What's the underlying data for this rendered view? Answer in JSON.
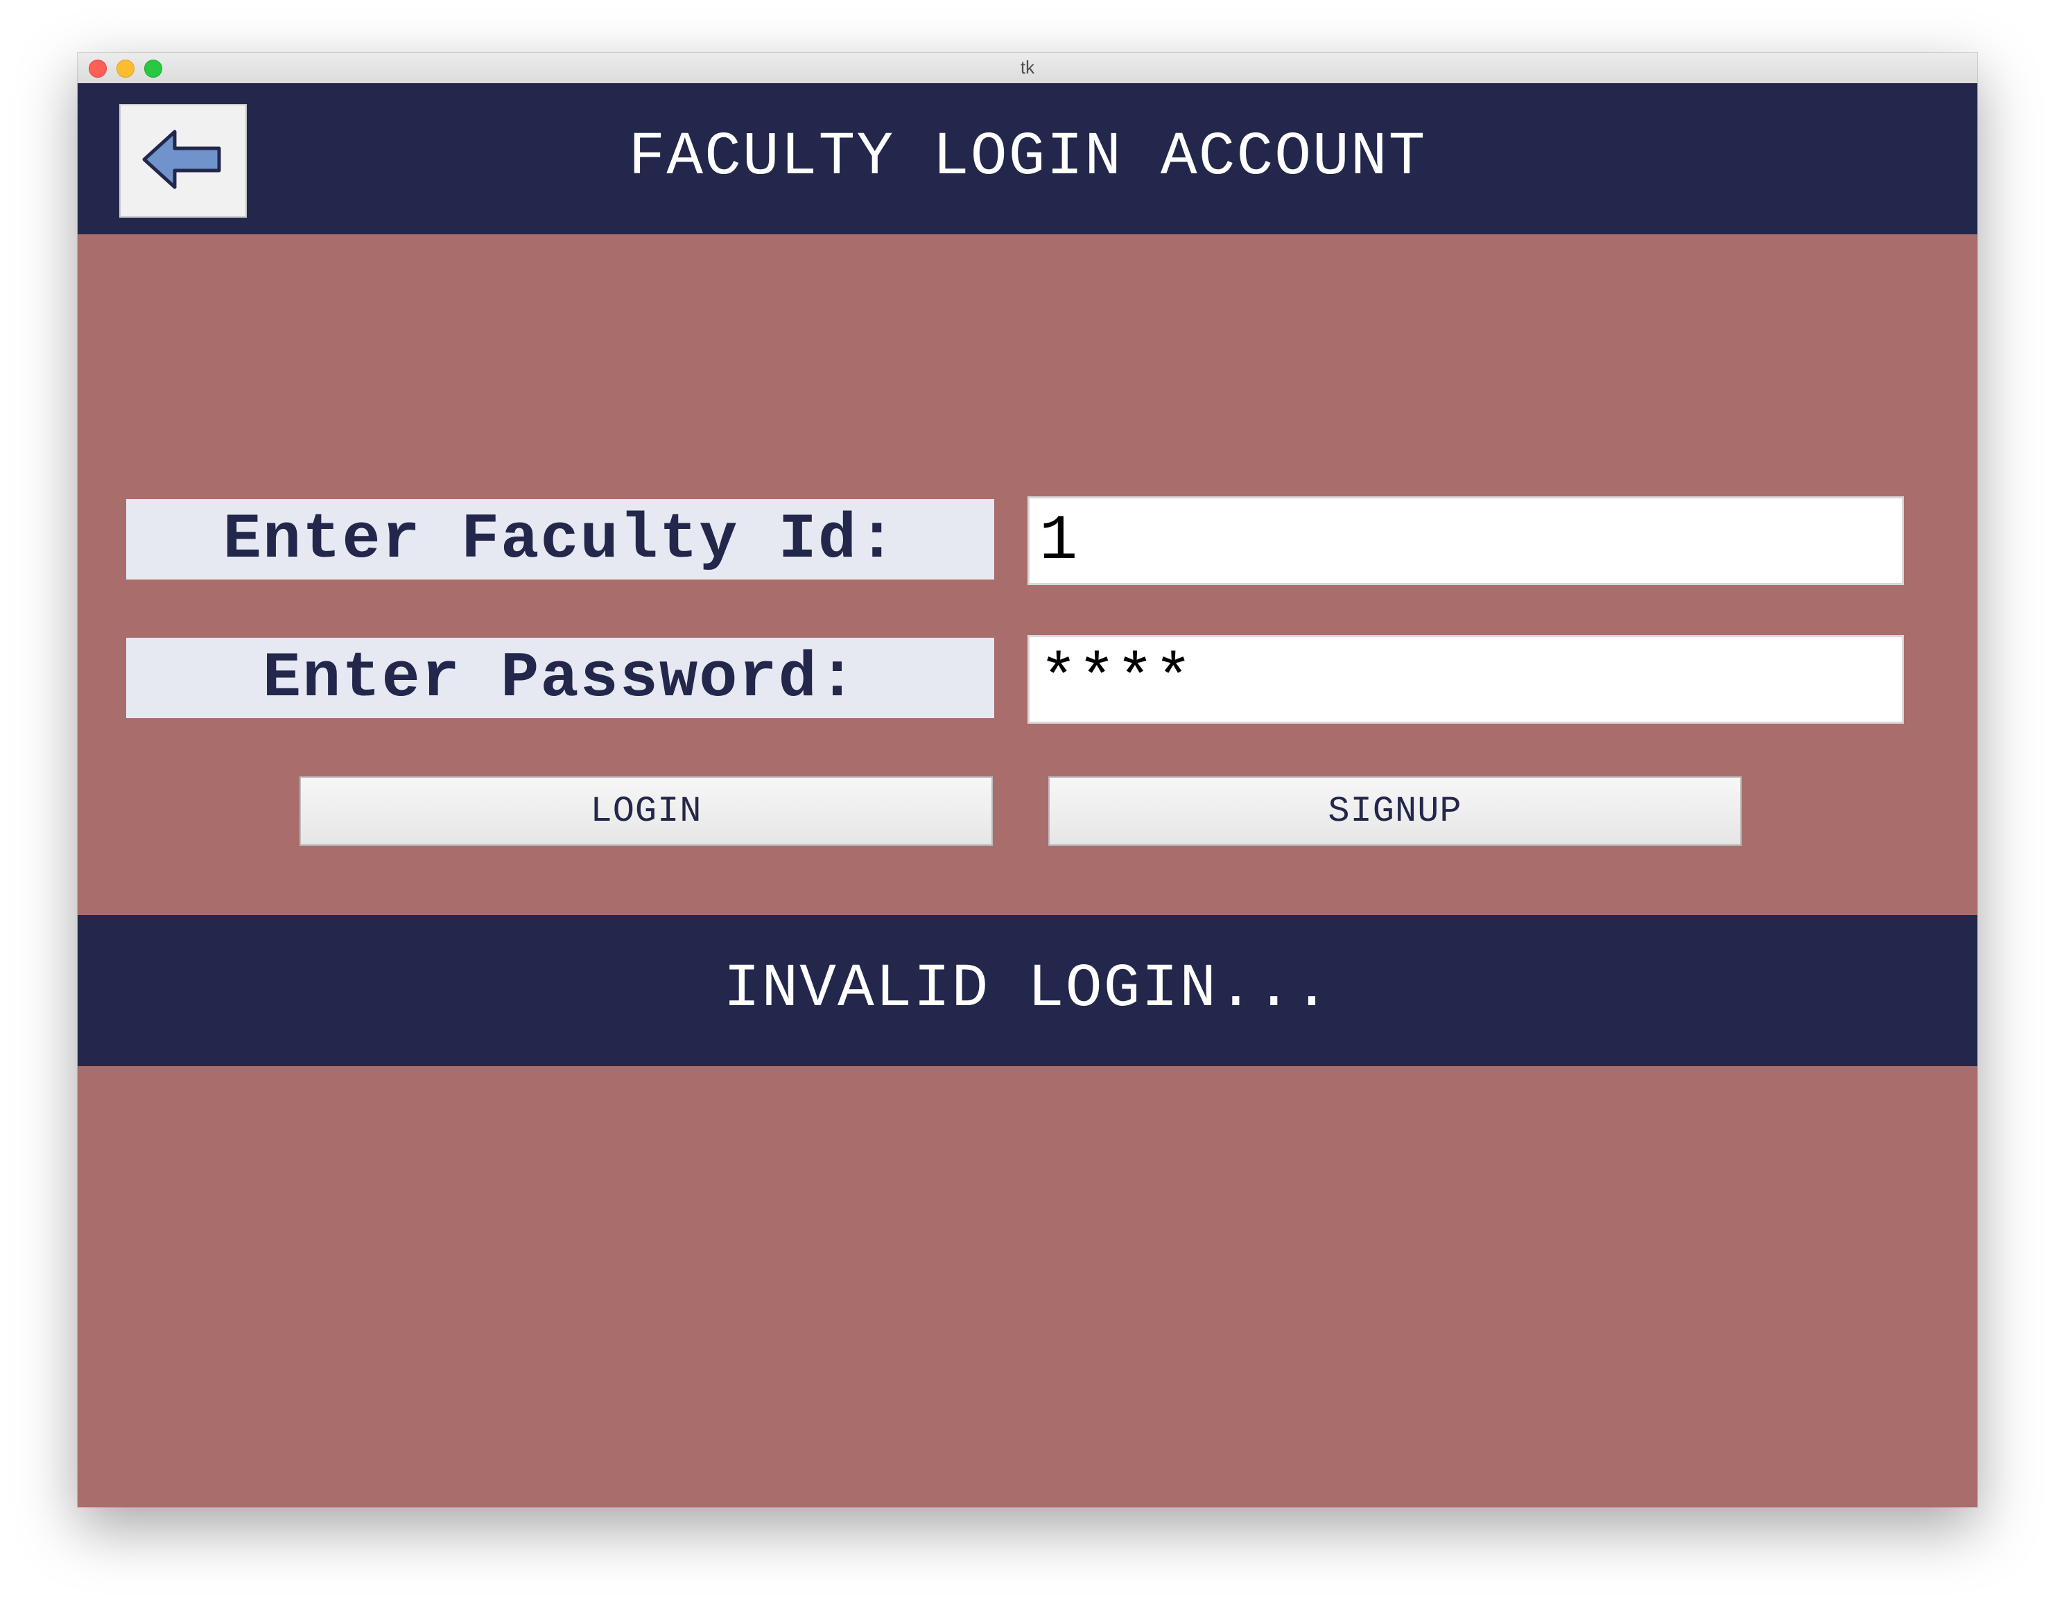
{
  "window": {
    "title": "tk"
  },
  "header": {
    "title": "FACULTY LOGIN ACCOUNT",
    "back_icon": "left-arrow-icon"
  },
  "form": {
    "faculty_id_label": "Enter Faculty Id:",
    "faculty_id_value": "1",
    "password_label": "Enter Password:",
    "password_value": "****"
  },
  "buttons": {
    "login_label": "LOGIN",
    "signup_label": "SIGNUP"
  },
  "status": {
    "message": "INVALID LOGIN..."
  },
  "colors": {
    "background": "#a96d6b",
    "bar": "#23274b",
    "label_bg": "#e6e9f2",
    "arrow_fill": "#6f94cc"
  }
}
